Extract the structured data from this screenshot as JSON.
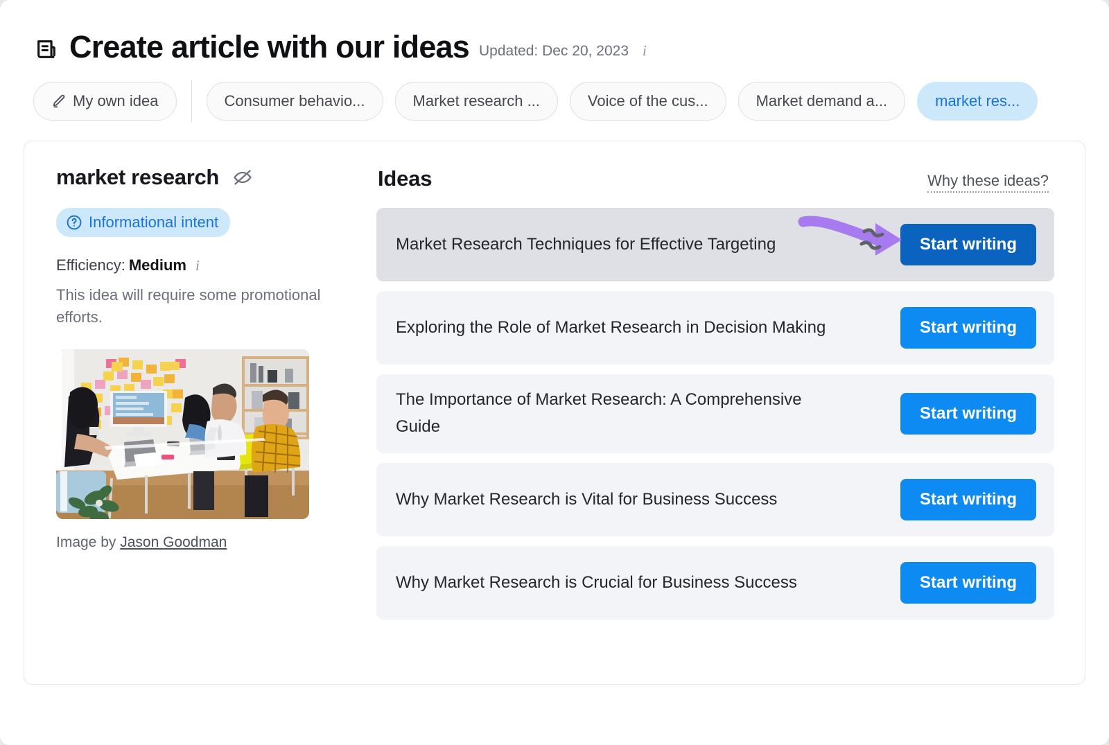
{
  "header": {
    "icon": "article-icon",
    "title": "Create article with our ideas",
    "updated": "Updated: Dec 20, 2023",
    "info_icon": "info-icon"
  },
  "tabs": [
    {
      "label": "My own idea",
      "icon": "pencil-icon",
      "active": false,
      "own": true
    },
    {
      "label": "Consumer behavio...",
      "active": false
    },
    {
      "label": "Market research ...",
      "active": false
    },
    {
      "label": "Voice of the cus...",
      "active": false
    },
    {
      "label": "Market demand a...",
      "active": false
    },
    {
      "label": "market res...",
      "active": true
    }
  ],
  "left_panel": {
    "keyword": "market research",
    "hide_icon": "eye-off-icon",
    "intent_badge": "Informational intent",
    "intent_icon": "question-circle-icon",
    "efficiency_label": "Efficiency:",
    "efficiency_value": "Medium",
    "efficiency_info_icon": "info-icon",
    "efficiency_description": "This idea will require some promotional efforts.",
    "image_alt": "team meeting around a white table with sticky notes",
    "credit_prefix": "Image by",
    "credit_author": "Jason Goodman"
  },
  "ideas_panel": {
    "title": "Ideas",
    "why_link": "Why these ideas?",
    "button_label": "Start writing",
    "items": [
      {
        "title": "Market Research Techniques for Effective Targeting",
        "hovered": true
      },
      {
        "title": "Exploring the Role of Market Research in Decision Making",
        "hovered": false
      },
      {
        "title": "The Importance of Market Research: A Comprehensive Guide",
        "hovered": false
      },
      {
        "title": "Why Market Research is Vital for Business Success",
        "hovered": false
      },
      {
        "title": "Why Market Research is Crucial for Business Success",
        "hovered": false
      }
    ]
  },
  "annotation": {
    "type": "curved-arrow",
    "color": "#a87aef",
    "points_to": "Start writing"
  },
  "colors": {
    "primary_blue": "#0d8bf2",
    "primary_blue_hover": "#0a63bf",
    "badge_blue_bg": "#cde8fb",
    "badge_blue_text": "#1a73d9",
    "row_bg": "#f3f4f8",
    "row_bg_hover": "#dfe0e6",
    "annotation_purple": "#a87aef"
  }
}
